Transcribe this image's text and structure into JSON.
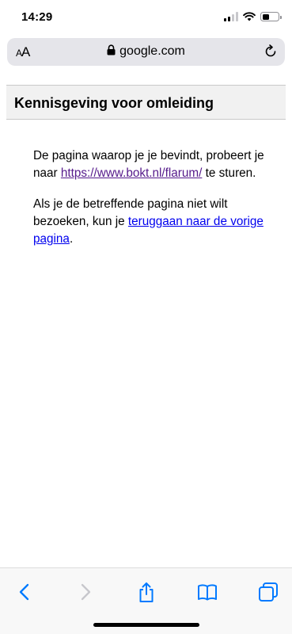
{
  "status_bar": {
    "time": "14:29"
  },
  "address_bar": {
    "text_size_label_small": "A",
    "text_size_label_large": "A",
    "url": "google.com"
  },
  "page": {
    "heading": "Kennisgeving voor omleiding",
    "para1_before": "De pagina waarop je je bevindt, probeert je naar ",
    "para1_link": "https://www.bokt.nl/flarum/",
    "para1_after": " te sturen.",
    "para2_before": "Als je de betreffende pagina niet wilt bezoeken, kun je ",
    "para2_link": "teruggaan naar de vorige pagina",
    "para2_after": "."
  },
  "toolbar": {
    "buttons": [
      "back",
      "forward",
      "share",
      "bookmarks",
      "tabs"
    ],
    "accent_color": "#007aff",
    "disabled_color": "#c7c7cc"
  }
}
